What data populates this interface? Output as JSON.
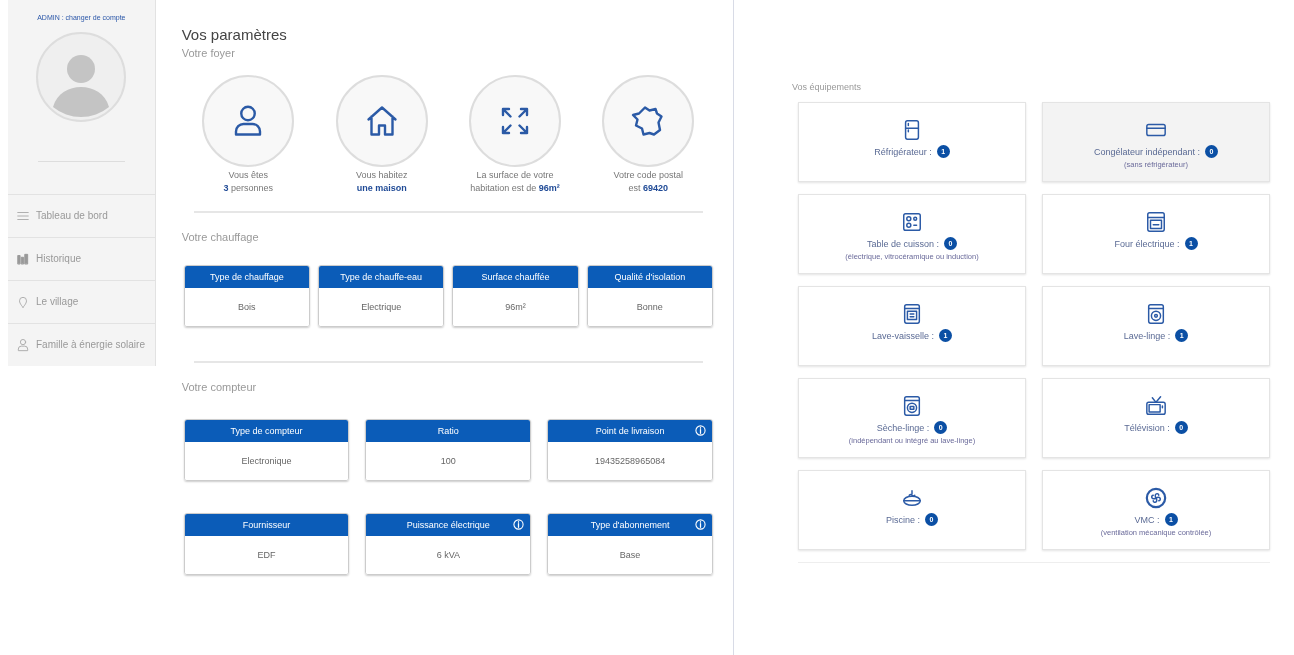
{
  "sidebar": {
    "account_link": "ADMIN : changer de compte",
    "items": [
      {
        "label": "Tableau de bord",
        "kind": "list"
      },
      {
        "label": "Historique",
        "kind": "chart"
      },
      {
        "label": "Le village",
        "kind": "pin"
      },
      {
        "label": "Famille à énergie solaire",
        "kind": "person"
      }
    ]
  },
  "settings": {
    "title": "Vos paramètres",
    "household_title": "Votre foyer",
    "household": [
      {
        "kind": "person",
        "lines": [
          "Vous êtes",
          "**3** personnes"
        ]
      },
      {
        "kind": "house",
        "lines": [
          "Vous habitez",
          "**une maison**"
        ]
      },
      {
        "kind": "expand",
        "lines": [
          "La surface de votre",
          "habitation est de **96m²**"
        ]
      },
      {
        "kind": "france",
        "lines": [
          "Votre code postal",
          "est **69420**"
        ]
      }
    ],
    "heating_title": "Votre chauffage",
    "heating": [
      {
        "header": "Type de chauffage",
        "value": "Bois",
        "info": false
      },
      {
        "header": "Type de chauffe-eau",
        "value": "Electrique",
        "info": false
      },
      {
        "header": "Surface chauffée",
        "value": "96m²",
        "info": false
      },
      {
        "header": "Qualité d'isolation",
        "value": "Bonne",
        "info": false
      }
    ],
    "meter_title": "Votre compteur",
    "meter_rows": [
      [
        {
          "header": "Type de compteur",
          "value": "Electronique",
          "info": false
        },
        {
          "header": "Ratio",
          "value": "100",
          "info": false
        },
        {
          "header": "Point de livraison",
          "value": "19435258965084",
          "info": true
        }
      ],
      [
        {
          "header": "Fournisseur",
          "value": "EDF",
          "info": false
        },
        {
          "header": "Puissance électrique",
          "value": "6 kVA",
          "info": true
        },
        {
          "header": "Type d'abonnement",
          "value": "Base",
          "info": true
        }
      ]
    ]
  },
  "equipment": {
    "title": "Vos équipements",
    "items": [
      {
        "kind": "fridge",
        "label": "Réfrigérateur :",
        "count": "1",
        "highlighted": false
      },
      {
        "kind": "freezer",
        "label": "Congélateur indépendant :",
        "count": "0",
        "note": "(sans réfrigérateur)",
        "highlighted": true
      },
      {
        "kind": "cooktop",
        "label": "Table de cuisson :",
        "count": "0",
        "note": "(électrique, vitrocéramique ou induction)",
        "highlighted": false
      },
      {
        "kind": "oven",
        "label": "Four électrique :",
        "count": "1",
        "highlighted": false
      },
      {
        "kind": "dishwasher",
        "label": "Lave-vaisselle :",
        "count": "1",
        "highlighted": false
      },
      {
        "kind": "washer",
        "label": "Lave-linge :",
        "count": "1",
        "highlighted": false
      },
      {
        "kind": "dryer",
        "label": "Sèche-linge :",
        "count": "0",
        "note": "(indépendant ou intégré au lave-linge)",
        "highlighted": false
      },
      {
        "kind": "tv",
        "label": "Télévision :",
        "count": "0",
        "highlighted": false
      },
      {
        "kind": "pool",
        "label": "Piscine :",
        "count": "0",
        "highlighted": false
      },
      {
        "kind": "fan",
        "label": "VMC :",
        "count": "1",
        "note": "(ventilation mécanique contrôlée)",
        "highlighted": false
      }
    ]
  }
}
